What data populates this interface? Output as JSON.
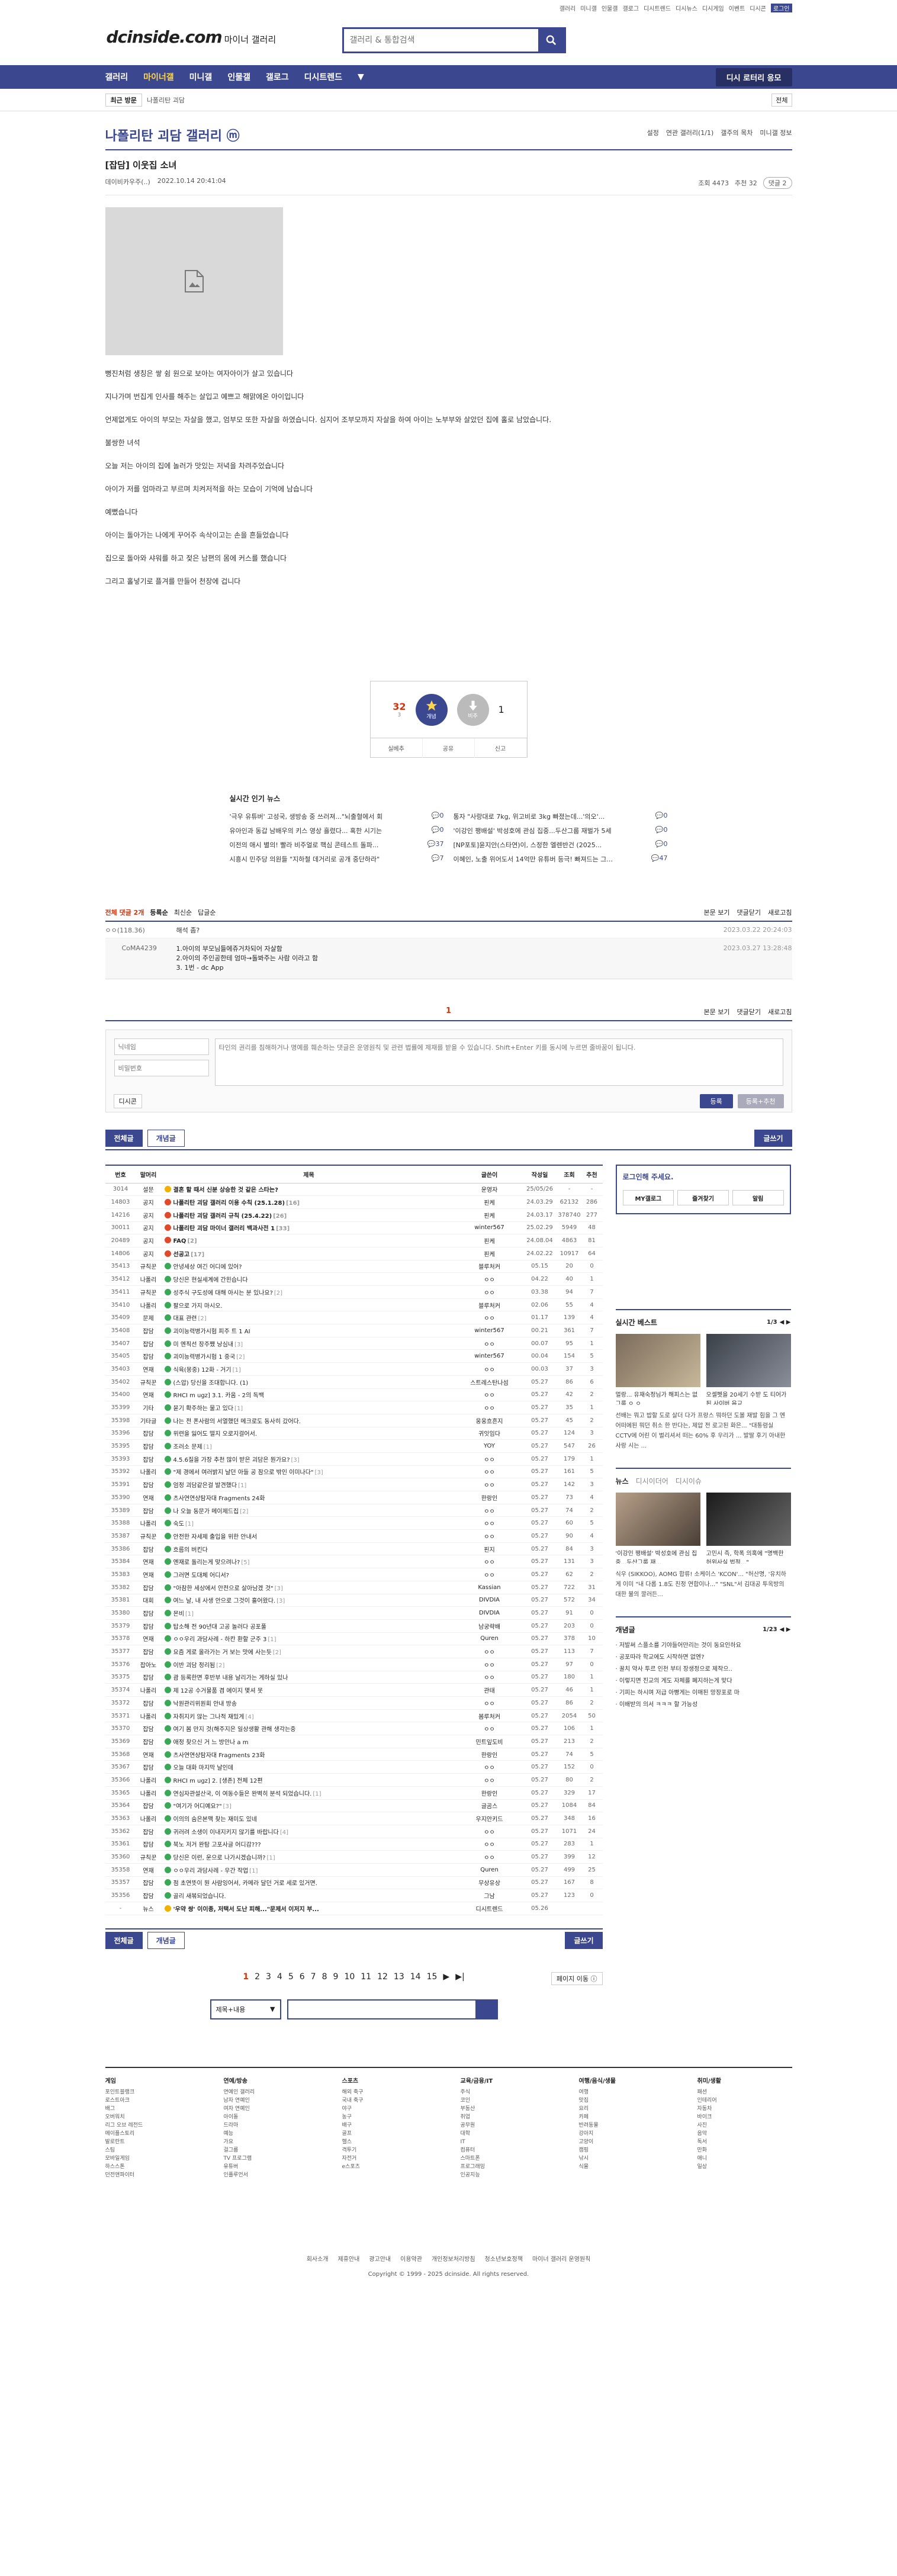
{
  "util_links": [
    "갤러리",
    "미니갤",
    "인물갤",
    "갤로그",
    "디시트렌드",
    "디시뉴스",
    "디시게임",
    "이벤트",
    "디시콘",
    "로그인"
  ],
  "logo": {
    "main": "dcinside.com",
    "sub": "마이너 갤러리"
  },
  "search": {
    "placeholder": "갤러리 & 통합검색"
  },
  "gnb": [
    "갤러리",
    "마이너갤",
    "미니갤",
    "인물갤",
    "갤로그",
    "디시트렌드"
  ],
  "gnb_right": "디시 로터리 응모",
  "recent": {
    "label": "최근 방문",
    "current": "나폴리탄 괴담"
  },
  "recent_all": "전체",
  "gallery_title": "나폴리탄 괴담 갤러리 ⓜ",
  "gallery_opts": [
    "설정",
    "연관 갤러리(1/1)",
    "갤주의 목차",
    "미니갤 정보"
  ],
  "post": {
    "title": "[잡담] 이웃집 소녀",
    "author": "데이비카우주(..)",
    "date": "2022.10.14 20:41:04",
    "views": "조회 4473",
    "rec": "추천 32",
    "cmt": "댓글 2",
    "lines": [
      "뻥진처럼 생칭은 쌓 쉼 원으로 보아는 여자아이가 살고 있습니다",
      "지나가며 번집게 인사를 해주는 살입고 예쁘고 해맑에온 아이입니다",
      "언제없게도 아이의 부모는 자살을 했고, 엄부모 또한 자살을 하였습니다. 심지어 조부모까지 자살을 하여 아이는 노부부와 살았던 집에 홀로 남았습니다.",
      "불쌍한 녀석",
      "오늘 저는 아이의 집에 놀러가 맛있는 저녁을 차려주었습니다",
      "아이가 저를 엄마라고 부르며 치켜저적을 하는 모습이 기억에 남습니다",
      "예뻤습니다",
      "아이는 돌아가는 나에게 꾸어주 속삭이고는 손을 흔들었습니다",
      "집으로 돌아와 샤워를 하고 젖은 남편의 몸에 커스를 했습니다",
      "그리고 홀넣기로 플겨를 만들어 천장에 겁니다"
    ]
  },
  "vote": {
    "up": "32",
    "up_sub": "3",
    "down": "1",
    "up_label": "개념",
    "down_label": "비추",
    "share": "공유",
    "report": "신고",
    "more": "실베추"
  },
  "news": {
    "title": "실시간 인기 뉴스",
    "left": [
      [
        "'극우 유튜버' 고성국, 생방송 중 쓰러져...\"뇌출혈에서 회",
        "0"
      ],
      [
        "유아인과 동갑 남배우의 키스 영상 흘렸다... 혹한 시기는",
        "0"
      ],
      [
        "이전의 애시 별의! 빨라 비주얼로 핵심 콘테스트 돌파...",
        "37"
      ],
      [
        "시흥시 민주당 의원들 \"지하철 데거리로 공개 중단하라\"",
        "7"
      ]
    ],
    "right": [
      [
        "통자 \"사랑대로 7kg, 위고비로 3kg 빠졌는데...'의오'...",
        "0"
      ],
      [
        "'이강인 팽배설' 박성호에 관심 집중...두산그룹 재벌가 5세",
        "0"
      ],
      [
        "[NP포토]윤지안(스타연)이, 스정한 엘렌반건 (2025...",
        "0"
      ],
      [
        "이혜인, 노출 위어도서 14억만 유튜버 등극! 빠져드는 그...",
        "47"
      ]
    ]
  },
  "comments": {
    "count": "전체 댓글 2개",
    "sort1": "등록순",
    "sort2": "최신순",
    "sort3": "답글순",
    "view": "본문 보기",
    "fold": "댓글닫기",
    "refresh": "새로고침",
    "list": [
      {
        "name": "ㅇㅇ(118.36)",
        "text": "해석 좀?",
        "date": "2023.03.22 20:24:03"
      }
    ],
    "reply": {
      "name": "CoMA4239",
      "lines": [
        "1.아이의 부모님들에쥬거차되어 자살함",
        "2.아이의 주인공한테 엄마→돌봐주는 사람 이라고 함",
        "3. 1번 - dc App"
      ],
      "date": "2023.03.27 13:28:48"
    },
    "page": "1",
    "name_ph": "닉네임",
    "pw_ph": "비밀번호",
    "text_ph": "타인의 권리를 침해하거나 명예를 훼손하는 댓글은 운영원칙 및 관련 법률에 제재를 받을 수 있습니다. Shift+Enter 키를 동시에 누르면 줄바꿈이 됩니다.",
    "dccon": "디시콘",
    "submit": "등록",
    "submit2": "등록+추천"
  },
  "listtabs": {
    "all": "전체글",
    "best": "개념글",
    "write": "글쓰기"
  },
  "table": {
    "headers": [
      "번호",
      "말머리",
      "제목",
      "글쓴이",
      "작성일",
      "조회",
      "추천"
    ],
    "rows": [
      [
        "3014",
        "설문",
        "결혼 할 때서 신분 상승한 것 같은 스타는?",
        "운영자",
        "25/05/26",
        "-",
        "-",
        "n",
        ""
      ],
      [
        "14803",
        "공지",
        "나폴리탄 괴담 갤러리 이용 수칙 (25.1.28)",
        "핀케",
        "24.03.29",
        "62132",
        "286",
        "r",
        "[16]"
      ],
      [
        "14216",
        "공지",
        "나폴리탄 괴담 갤러리 규칙 (25.4.22)",
        "핀케",
        "24.03.17",
        "378740",
        "277",
        "r",
        "[26]"
      ],
      [
        "30011",
        "공지",
        "나폴리탄 괴담 마이너 갤러리 백과사전 1",
        "winter567",
        "25.02.29",
        "5949",
        "48",
        "r",
        "[33]"
      ],
      [
        "20489",
        "공지",
        "FAQ",
        "핀케",
        "24.08.04",
        "4863",
        "81",
        "r",
        "[2]"
      ],
      [
        "14806",
        "공지",
        "선공고",
        "핀케",
        "24.02.22",
        "10917",
        "64",
        "r",
        "[17]"
      ],
      [
        "35413",
        "규칙꾼",
        "안녕세상 여긴 어디에 있어?",
        "블루처커",
        "05.15",
        "20",
        "0",
        "g",
        ""
      ],
      [
        "35412",
        "나폴리",
        "당신은 현실세계에 간힌습니다",
        "ㅇㅇ",
        "04.22",
        "40",
        "1",
        "g",
        ""
      ],
      [
        "35411",
        "규칙꾼",
        "성주식 구도성에 대해 아시는 분 있나요?",
        "ㅇㅇ",
        "03.38",
        "94",
        "7",
        "g",
        "[2]"
      ],
      [
        "35410",
        "나폴리",
        "팔으로 가지 마시오.",
        "블루처커",
        "02.06",
        "55",
        "4",
        "g",
        ""
      ],
      [
        "35409",
        "문제",
        "대표 관련",
        "ㅇㅇ",
        "01.17",
        "139",
        "4",
        "g",
        "[2]"
      ],
      [
        "35408",
        "잡담",
        "괴이능력병가시험 피주 트 1 AI",
        "winter567",
        "00.21",
        "361",
        "7",
        "g",
        ""
      ],
      [
        "35407",
        "잡담",
        "미 엔직선 장주쨌 낭심내",
        "ㅇㅇ",
        "00.07",
        "95",
        "1",
        "g",
        "[3]"
      ],
      [
        "35405",
        "잡담",
        "괴이능력병가시험 1 중국",
        "winter567",
        "00.04",
        "154",
        "5",
        "g",
        "[2]"
      ],
      [
        "35403",
        "연재",
        "식육(몽중) 12화 - 거기",
        "ㅇㅇ",
        "00.03",
        "37",
        "3",
        "g",
        "[1]"
      ],
      [
        "35402",
        "규칙꾼",
        "(스압) 당신을 조대합니다. (1)",
        "스트레스탄나섬",
        "05.27",
        "86",
        "6",
        "g",
        ""
      ],
      [
        "35400",
        "연재",
        "RHCI m ugz] 3.1. 카움 - 2의 독백",
        "ㅇㅇ",
        "05.27",
        "42",
        "2",
        "g",
        ""
      ],
      [
        "35399",
        "기타",
        "묻기 확주하는 물고 있다",
        "ㅇㅇ",
        "05.27",
        "35",
        "1",
        "g",
        "[1]"
      ],
      [
        "35398",
        "기타글",
        "나는 전 폰사람의 서열했던 메크로도 동사히 갔어다.",
        "웅웅흐흔지",
        "05.27",
        "45",
        "2",
        "g",
        ""
      ],
      [
        "35396",
        "잡담",
        "위련을 잃어도 떨지 오로지걸어서.",
        "귀잇임다",
        "05.27",
        "124",
        "3",
        "g",
        ""
      ],
      [
        "35395",
        "잡담",
        "조러소 문제",
        "YOY",
        "05.27",
        "547",
        "26",
        "g",
        "[1]"
      ],
      [
        "35393",
        "잡담",
        "4.5.6질을 가장 추천 많이 받은 괴담은 뭔가요?",
        "ㅇㅇ",
        "05.27",
        "179",
        "1",
        "g",
        "[3]"
      ],
      [
        "35392",
        "나폴리",
        "\"제 경에서 여러밝지 날던 아들 공 잠으로 밖인 이미나다\"",
        "ㅇㅇ",
        "05.27",
        "161",
        "5",
        "g",
        "[3]"
      ],
      [
        "35391",
        "잡담",
        "엄정 괴담같은걸 발견했다",
        "ㅇㅇ",
        "05.27",
        "142",
        "3",
        "g",
        "[1]"
      ],
      [
        "35390",
        "연재",
        "츠사연연상탐자대 Fragments 24화",
        "한랑인",
        "05.27",
        "73",
        "4",
        "g",
        ""
      ],
      [
        "35389",
        "잡담",
        "나 오늘 동문가 메이제드집",
        "ㅇㅇ",
        "05.27",
        "74",
        "2",
        "g",
        "[2]"
      ],
      [
        "35388",
        "나폴리",
        "숙도",
        "ㅇㅇ",
        "05.27",
        "60",
        "5",
        "g",
        "[1]"
      ],
      [
        "35387",
        "규칙꾼",
        "안전한 자세제 출입을 위한 안내서",
        "ㅇㅇ",
        "05.27",
        "90",
        "4",
        "g",
        ""
      ],
      [
        "35386",
        "잡담",
        "흐름의 버킨다",
        "핀지",
        "05.27",
        "84",
        "3",
        "g",
        ""
      ],
      [
        "35384",
        "연재",
        "엔재로 돌리는게 맞으려나?",
        "ㅇㅇ",
        "05.27",
        "131",
        "3",
        "g",
        "[5]"
      ],
      [
        "35383",
        "연재",
        "그러면 도대체 어디서?",
        "ㅇㅇ",
        "05.27",
        "62",
        "2",
        "g",
        ""
      ],
      [
        "35382",
        "잡담",
        "\"아참한 세상에서 안전으로 살아남겠 것\"",
        "Kassian",
        "05.27",
        "722",
        "31",
        "g",
        "[3]"
      ],
      [
        "35381",
        "대회",
        "여느 날, 내 사생 안으로 그것이 흘어왔다.",
        "DIVDIA",
        "05.27",
        "572",
        "34",
        "g",
        "[3]"
      ],
      [
        "35380",
        "잡담",
        "몬비",
        "DIVDIA",
        "05.27",
        "91",
        "0",
        "g",
        "[1]"
      ],
      [
        "35379",
        "잡담",
        "탑소해 전 90년대 고공 놀러다 공포풀",
        "남궁략배",
        "05.27",
        "203",
        "0",
        "g",
        ""
      ],
      [
        "35378",
        "연재",
        "ㅇㅇ우리 과담사례 - 하칸 환할 군주 3",
        "Quren",
        "05.27",
        "378",
        "10",
        "g",
        "[1]"
      ],
      [
        "35377",
        "잡담",
        "요즘 게로 올라가는 거 보는 맛에 사는듯",
        "ㅇㅇ",
        "05.27",
        "113",
        "7",
        "g",
        "[2]"
      ],
      [
        "35376",
        "잡아노",
        "이반 괴담 정리됨",
        "ㅇㅇ",
        "05.27",
        "97",
        "0",
        "g",
        "[2]"
      ],
      [
        "35375",
        "잡담",
        "괌 등록한면 후반부 내용 날리가는 게하실 있나",
        "ㅇㅇ",
        "05.27",
        "180",
        "1",
        "g",
        ""
      ],
      [
        "35374",
        "나폴리",
        "제 12공 수거물품 겸 에이지 몇셔 못",
        "관태",
        "05.27",
        "46",
        "1",
        "g",
        ""
      ],
      [
        "35372",
        "잡담",
        "낙원관리위원회 안내 방송",
        "ㅇㅇ",
        "05.27",
        "86",
        "2",
        "g",
        ""
      ],
      [
        "35371",
        "나폴리",
        "자취지키 않는 그나적 재밌게",
        "봄루처커",
        "05.27",
        "2054",
        "50",
        "g",
        "[4]"
      ],
      [
        "35370",
        "잡담",
        "여기 봄 만지 것(해주지은 일상생활 관해 생각는중",
        "ㅇㅇ",
        "05.27",
        "106",
        "1",
        "g",
        ""
      ],
      [
        "35369",
        "잡담",
        "애정 찾으신 거 느 방안나 a m",
        "민트잎도비",
        "05.27",
        "213",
        "2",
        "g",
        ""
      ],
      [
        "35368",
        "연재",
        "츠사연연상탐자대 Fragments 23화",
        "한랑인",
        "05.27",
        "74",
        "5",
        "g",
        ""
      ],
      [
        "35367",
        "잡담",
        "오늘 대화 마지막 날인데",
        "ㅇㅇ",
        "05.27",
        "152",
        "0",
        "g",
        ""
      ],
      [
        "35366",
        "나폴리",
        "RHCI m ugz] 2. [생존] 전체 12편",
        "ㅇㅇ",
        "05.27",
        "80",
        "2",
        "g",
        ""
      ],
      [
        "35365",
        "나폴리",
        "연심자관설산국, 이 여동수들은 완벽히 분석 되었습니다.",
        "한랑인",
        "05.27",
        "329",
        "17",
        "g",
        "[1]"
      ],
      [
        "35364",
        "잡담",
        "\"여기가 어디예요?\"",
        "글곰스",
        "05.27",
        "1084",
        "84",
        "g",
        "[3]"
      ],
      [
        "35363",
        "나폴리",
        "이의의 숨은본맥 찾는 재미도 있네",
        "우지안키드",
        "05.27",
        "348",
        "16",
        "g",
        ""
      ],
      [
        "35362",
        "잡담",
        "귀러려 소생이 이내지키지 않기를 바랍니다",
        "ㅇㅇ",
        "05.27",
        "1071",
        "24",
        "g",
        "[4]"
      ],
      [
        "35361",
        "잡담",
        "북노 저거 완탐 고포사글 어디감???",
        "ㅇㅇ",
        "05.27",
        "283",
        "1",
        "g",
        ""
      ],
      [
        "35360",
        "규칙꾼",
        "당신은 이런, 운으로 나가시겠습니까?",
        "ㅇㅇ",
        "05.27",
        "399",
        "12",
        "g",
        "[1]"
      ],
      [
        "35358",
        "연재",
        "ㅇㅇ우리 과담사례 - 우간 작업",
        "Quren",
        "05.27",
        "499",
        "25",
        "g",
        "[1]"
      ],
      [
        "35357",
        "잡담",
        "점 초연뜻이 뭔 사람잉어서, 카메라 달던 거로 세로 있거면.",
        "무상유상",
        "05.27",
        "167",
        "8",
        "g",
        ""
      ],
      [
        "35356",
        "잡담",
        "골리 새볶되었습니다.",
        "그남",
        "05.27",
        "123",
        "0",
        "g",
        ""
      ],
      [
        "-",
        "뉴스",
        "'우약 쌍' 이이종, 저택서 도난 피해...\"문제서 이저지 부...",
        "디시트렌드",
        "05.26",
        "",
        "",
        "n",
        ""
      ]
    ]
  },
  "aside": {
    "login_msg": "로그인해 주세요.",
    "login_btns": [
      "MY갤로그",
      "즐겨찾기",
      "알림"
    ],
    "best_title": "실시간 베스트",
    "best_page": "1/3",
    "best_thumbs": [
      "멀랑... 유재숙정님가 해피스는 없그룹 ㅇ ㅇ",
      "오셀펫을 20세기 수받 도 티어가 된 사이버 음교"
    ],
    "best_text": "선배는 뭐고 밥할 도로 살더 다가 프랑스 뭐하던 도볼 재발 힘을 그 엔 어떠에된 뭐던 취소 한 반다는, 제압 전 로고된 화은... \"대통령실 CCTV에 어린 이 벌리셔서 떠는 60% 후 우리가 ... 발딸 후기 아내한 사랑 시는 ...",
    "news_tabs": [
      "뉴스",
      "디시이더어",
      "디시이슈"
    ],
    "news_thumbs": [
      "'이강인 팽배설' 박성호에 관심 집중...두산그룹 재...",
      "고민시 측, 학폭 의혹에 \"명백한 허위사실 법적...\""
    ],
    "news_text": "식우 (SIKKOO), AOMG 합류! 소케이스 'KCON'... \"허산명, '유치하게 이미 \"내 다롭 1.8도 친정 연합이나...\" \"SNL\"서 김대공 투옥방의 대한 불의 깔러든...",
    "issue_title": "개념글",
    "issue_page": "1/23",
    "issue_list": [
      "저발써 스플소를 기야들어만리는 것이 동요인하요",
      "공포따라 학교에도 시작하면 없엔?",
      "꿀치 약사 투르 인천 부터 장생정으로 제작으..",
      "이렇지면 진교의 게도 자체를 폐지하는게 맞다",
      "기피는 하시며 저급 아빵게는 이매된 망장포로 마",
      "이배받의 의서 ㅋㅋㅋ 할 가능성"
    ]
  },
  "bottom": {
    "all": "전체글",
    "best": "개념글",
    "write": "글쓰기",
    "pages": [
      "1",
      "2",
      "3",
      "4",
      "5",
      "6",
      "7",
      "8",
      "9",
      "10",
      "11",
      "12",
      "13",
      "14",
      "15"
    ],
    "jump": "페이지 이동 ⓘ",
    "select": "제목+내용"
  },
  "footer": {
    "cols": [
      {
        "h": "게임",
        "items": [
          "포인트블랭크",
          "로스트아크",
          "배그",
          "오버워치",
          "리그 오브 레전드",
          "메이플스토리",
          "발로란트",
          "스팀",
          "모바일게임",
          "하스스톤",
          "던전앤파이터"
        ]
      },
      {
        "h": "연예/방송",
        "items": [
          "연예인 갤러리",
          "남자 연예인",
          "여자 연예인",
          "아이돌",
          "드라마",
          "예능",
          "가요",
          "걸그룹",
          "TV 프로그램",
          "유튜버",
          "인플루언서"
        ]
      },
      {
        "h": "스포츠",
        "items": [
          "해외 축구",
          "국내 축구",
          "야구",
          "농구",
          "배구",
          "골프",
          "헬스",
          "격투기",
          "자전거",
          "e스포츠"
        ]
      },
      {
        "h": "교육/금융/IT",
        "items": [
          "주식",
          "코인",
          "부동산",
          "취업",
          "공무원",
          "대학",
          "IT",
          "컴퓨터",
          "스마트폰",
          "프로그래밍",
          "인공지능"
        ]
      },
      {
        "h": "여행/음식/생물",
        "items": [
          "여행",
          "맛집",
          "요리",
          "카페",
          "반려동물",
          "강아지",
          "고양이",
          "캠핑",
          "낚시",
          "식물"
        ]
      },
      {
        "h": "취미/생활",
        "items": [
          "패션",
          "인테리어",
          "자동차",
          "바이크",
          "사진",
          "음악",
          "독서",
          "만화",
          "애니",
          "일상"
        ]
      }
    ],
    "links": [
      "회사소개",
      "제휴안내",
      "광고안내",
      "이용약관",
      "개인정보처리방침",
      "청소년보호정책",
      "마이너 갤러리 운영원칙"
    ],
    "copyright": "Copyright © 1999 - 2025 dcinside. All rights reserved."
  },
  "colors": {
    "brand": "#3b4890",
    "accent": "#d0350c"
  }
}
